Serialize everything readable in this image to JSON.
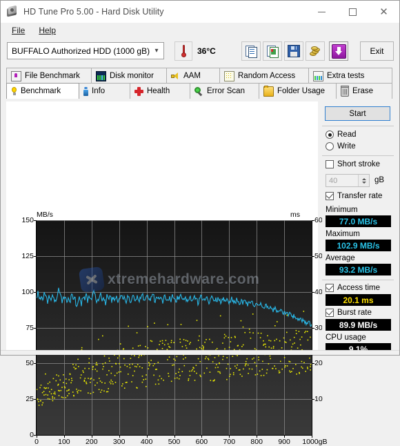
{
  "window": {
    "title": "HD Tune Pro 5.00 - Hard Disk Utility",
    "app_icon": "hard-disk-icon",
    "minimize": "minimize-icon",
    "maximize": "maximize-icon",
    "close": "close-icon"
  },
  "menu": {
    "items": [
      {
        "label": "File"
      },
      {
        "label": "Help"
      }
    ]
  },
  "toolbar": {
    "drive": "BUFFALO Authorized HDD   (1000 gB)",
    "drive_chevron": "chevron-down-icon",
    "temperature": "36°C",
    "thermometer_icon": "thermometer-icon",
    "buttons": [
      {
        "icon": "copy-text-icon"
      },
      {
        "icon": "copy-image-icon"
      },
      {
        "icon": "save-floppy-icon"
      },
      {
        "icon": "gold-coins-icon"
      },
      {
        "icon": "download-arrow-icon"
      }
    ],
    "exit_label": "Exit"
  },
  "tabs": {
    "row1": [
      {
        "label": "File Benchmark",
        "icon": "file-benchmark-icon",
        "active": false
      },
      {
        "label": "Disk monitor",
        "icon": "disk-monitor-icon",
        "active": false
      },
      {
        "label": "AAM",
        "icon": "speaker-icon",
        "active": false
      },
      {
        "label": "Random Access",
        "icon": "random-access-icon",
        "active": false
      },
      {
        "label": "Extra tests",
        "icon": "extra-tests-icon",
        "active": false
      }
    ],
    "row2": [
      {
        "label": "Benchmark",
        "icon": "lightbulb-icon",
        "active": true
      },
      {
        "label": "Info",
        "icon": "info-icon",
        "active": false
      },
      {
        "label": "Health",
        "icon": "health-cross-icon",
        "active": false
      },
      {
        "label": "Error Scan",
        "icon": "magnifier-icon",
        "active": false
      },
      {
        "label": "Folder Usage",
        "icon": "folder-icon",
        "active": false
      },
      {
        "label": "Erase",
        "icon": "trash-icon",
        "active": false
      }
    ]
  },
  "chart_data": {
    "type": "line",
    "title": "",
    "watermark": "xtremehardware.com",
    "xlabel": "1000gB",
    "x_unit": "gB",
    "ylabel": "MB/s",
    "ylabel_right": "ms",
    "xlim": [
      0,
      1000
    ],
    "ylim": [
      0,
      150
    ],
    "ylim_right": [
      0,
      60
    ],
    "grid": true,
    "x_ticks": [
      "0",
      "100",
      "200",
      "300",
      "400",
      "500",
      "600",
      "700",
      "800",
      "900",
      "1000gB"
    ],
    "x_tick_values": [
      0,
      100,
      200,
      300,
      400,
      500,
      600,
      700,
      800,
      900,
      1000
    ],
    "y_ticks_left": [
      "0",
      "25",
      "50",
      "75",
      "100",
      "125",
      "150"
    ],
    "y_tick_values_left": [
      0,
      25,
      50,
      75,
      100,
      125,
      150
    ],
    "y_ticks_right": [
      "10",
      "20",
      "30",
      "40",
      "50",
      "60"
    ],
    "y_tick_values_right": [
      10,
      20,
      30,
      40,
      50,
      60
    ],
    "series": [
      {
        "name": "Transfer rate",
        "color": "#29b8e8",
        "axis": "left",
        "unit": "MB/s",
        "values": [
          95.5,
          100.2,
          94.0,
          96.5,
          93.0,
          100.5,
          96.0,
          92.0,
          97.5,
          94.5,
          99.0,
          95.0,
          91.5,
          96.0,
          102.9,
          97.0,
          93.5,
          95.5,
          98.0,
          94.0,
          96.5,
          92.5,
          99.5,
          95.0,
          97.0,
          88.5,
          94.5,
          96.0,
          91.0,
          97.5,
          95.0,
          99.0,
          93.0,
          96.5,
          94.0,
          97.0,
          101.5,
          95.5,
          92.0,
          96.0,
          98.5,
          94.5,
          96.0,
          91.5,
          97.0,
          95.0,
          99.0,
          93.5,
          96.5,
          94.0,
          97.5,
          92.0,
          95.5,
          98.0,
          94.0,
          96.0,
          90.5,
          97.0,
          95.0,
          93.0,
          98.5,
          96.0,
          94.5,
          97.5,
          92.5,
          96.0,
          99.0,
          95.0,
          93.5,
          97.0,
          95.5,
          94.0,
          96.5,
          98.0,
          93.0,
          95.0,
          97.0,
          94.5,
          96.0,
          92.0,
          98.0,
          95.5,
          93.0,
          96.5,
          94.0,
          97.0,
          95.0,
          92.5,
          96.0,
          94.5,
          97.5,
          95.0,
          93.5,
          96.0,
          94.0,
          95.5,
          97.0,
          93.0,
          95.0,
          96.5,
          94.5,
          92.0,
          95.5,
          97.0,
          93.5,
          95.0,
          96.0,
          94.0,
          92.5,
          95.5,
          97.0,
          93.0,
          95.0,
          94.5,
          96.0,
          92.0,
          94.5,
          95.5,
          93.0,
          94.0,
          92.5,
          94.0,
          95.0,
          93.5,
          92.0,
          94.5,
          93.0,
          91.5,
          93.5,
          92.0,
          94.0,
          92.5,
          91.0,
          93.0,
          91.5,
          92.5,
          90.5,
          92.0,
          91.0,
          90.0,
          91.5,
          90.0,
          89.0,
          90.5,
          89.5,
          88.0,
          89.5,
          88.5,
          87.0,
          88.5,
          87.5,
          86.0,
          87.0,
          86.0,
          85.0,
          86.0,
          85.0,
          84.0,
          84.5,
          83.5,
          82.5,
          83.5,
          82.0,
          81.0,
          82.0,
          80.5,
          79.5,
          80.5,
          79.0,
          78.0,
          78.5,
          77.5,
          77.0
        ]
      },
      {
        "name": "Access time",
        "color": "#eeee00",
        "axis": "right",
        "unit": "ms",
        "style": "scatter",
        "mean_trend": [
          10.5,
          12.0,
          13.5,
          14.5,
          15.5,
          16.2,
          17.0,
          17.6,
          18.2,
          18.8,
          19.2,
          19.6,
          20.0,
          20.3,
          20.6,
          20.9,
          21.2,
          21.4,
          21.6,
          21.8,
          22.0,
          22.2,
          22.4,
          22.6,
          22.8,
          23.0,
          23.2,
          23.4,
          23.5,
          23.6
        ],
        "spread": 6.5
      }
    ]
  },
  "panel": {
    "start_label": "Start",
    "mode": {
      "read_label": "Read",
      "write_label": "Write",
      "selected": "Read"
    },
    "short_stroke": {
      "label": "Short stroke",
      "checked": false,
      "value": "40",
      "unit": "gB"
    },
    "transfer_rate": {
      "label": "Transfer rate",
      "checked": true
    },
    "minimum": {
      "label": "Minimum",
      "value": "77.0 MB/s",
      "color": "#29c3e8"
    },
    "maximum": {
      "label": "Maximum",
      "value": "102.9 MB/s",
      "color": "#29c3e8"
    },
    "average": {
      "label": "Average",
      "value": "93.2 MB/s",
      "color": "#29c3e8"
    },
    "access_time": {
      "label": "Access time",
      "checked": true,
      "value": "20.1 ms",
      "color": "#ffe000"
    },
    "burst_rate": {
      "label": "Burst rate",
      "checked": true,
      "value": "89.9 MB/s",
      "color": "#ffffff"
    },
    "cpu_usage": {
      "label": "CPU usage",
      "value": "9.1%",
      "color": "#ffffff"
    }
  }
}
